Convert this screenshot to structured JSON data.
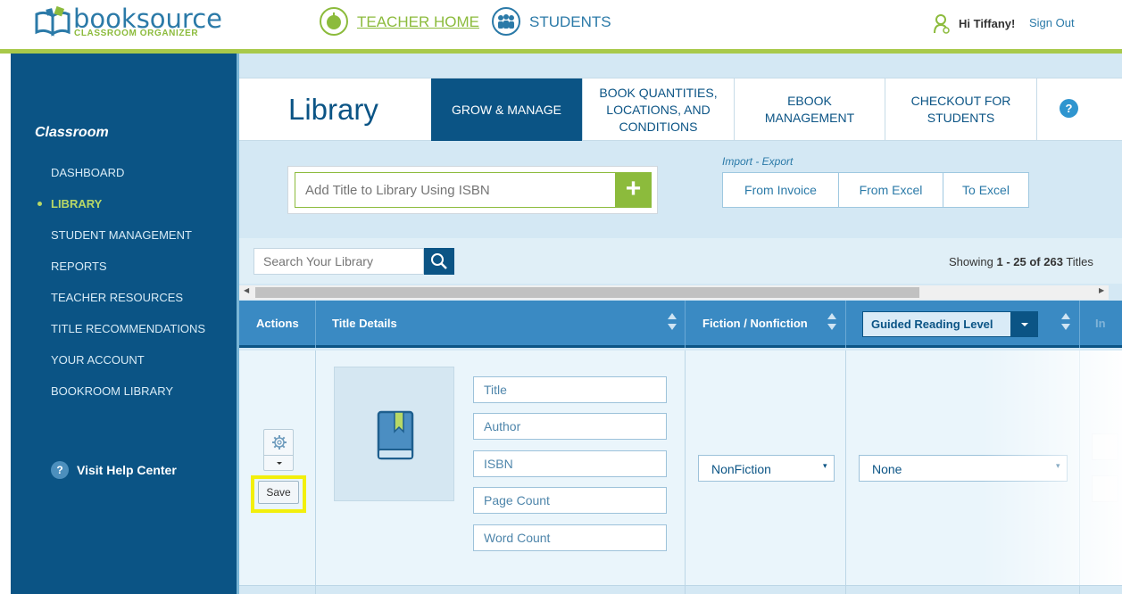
{
  "brand": {
    "name": "booksource",
    "subtitle": "CLASSROOM ORGANIZER",
    "accent": "#8cbb3c",
    "primary": "#0b5485"
  },
  "top_nav": {
    "teacher_home": "TEACHER HOME",
    "students": "STUDENTS",
    "greeting": "Hi Tiffany!",
    "sign_out": "Sign Out"
  },
  "sidebar": {
    "heading": "Classroom",
    "items": [
      {
        "label": "DASHBOARD",
        "active": false
      },
      {
        "label": "LIBRARY",
        "active": true
      },
      {
        "label": "STUDENT MANAGEMENT",
        "active": false
      },
      {
        "label": "REPORTS",
        "active": false
      },
      {
        "label": "TEACHER RESOURCES",
        "active": false
      },
      {
        "label": "TITLE RECOMMENDATIONS",
        "active": false
      },
      {
        "label": "YOUR ACCOUNT",
        "active": false
      },
      {
        "label": "BOOKROOM LIBRARY",
        "active": false
      }
    ],
    "help": {
      "icon": "?",
      "label": "Visit Help Center"
    }
  },
  "page": {
    "title": "Library",
    "tabs": [
      {
        "label": "GROW & MANAGE",
        "active": true
      },
      {
        "label": "BOOK QUANTITIES, LOCATIONS, AND CONDITIONS",
        "active": false
      },
      {
        "label": "eBOOK MANAGEMENT",
        "active": false
      },
      {
        "label": "CHECKOUT FOR STUDENTS",
        "active": false
      }
    ],
    "help_icon": "?"
  },
  "isbn": {
    "placeholder": "Add Title to Library Using ISBN",
    "add_icon": "+"
  },
  "import_export": {
    "label": "Import - Export",
    "buttons": [
      "From Invoice",
      "From Excel",
      "To Excel"
    ]
  },
  "search": {
    "placeholder": "Search Your Library"
  },
  "showing": {
    "prefix": "Showing ",
    "range": "1 - 25",
    "of": " of ",
    "total": "263",
    "suffix": " Titles"
  },
  "table": {
    "headers": {
      "actions": "Actions",
      "title_details": "Title Details",
      "fiction": "Fiction / Nonfiction",
      "grl": "Guided Reading Level",
      "next": "In"
    },
    "row": {
      "save": "Save",
      "fields": [
        {
          "placeholder": "Title"
        },
        {
          "placeholder": "Author"
        },
        {
          "placeholder": "ISBN"
        },
        {
          "placeholder": "Page Count"
        },
        {
          "placeholder": "Word Count"
        }
      ],
      "fiction_value": "NonFiction",
      "grl_value": "None",
      "caret": "▾"
    }
  }
}
